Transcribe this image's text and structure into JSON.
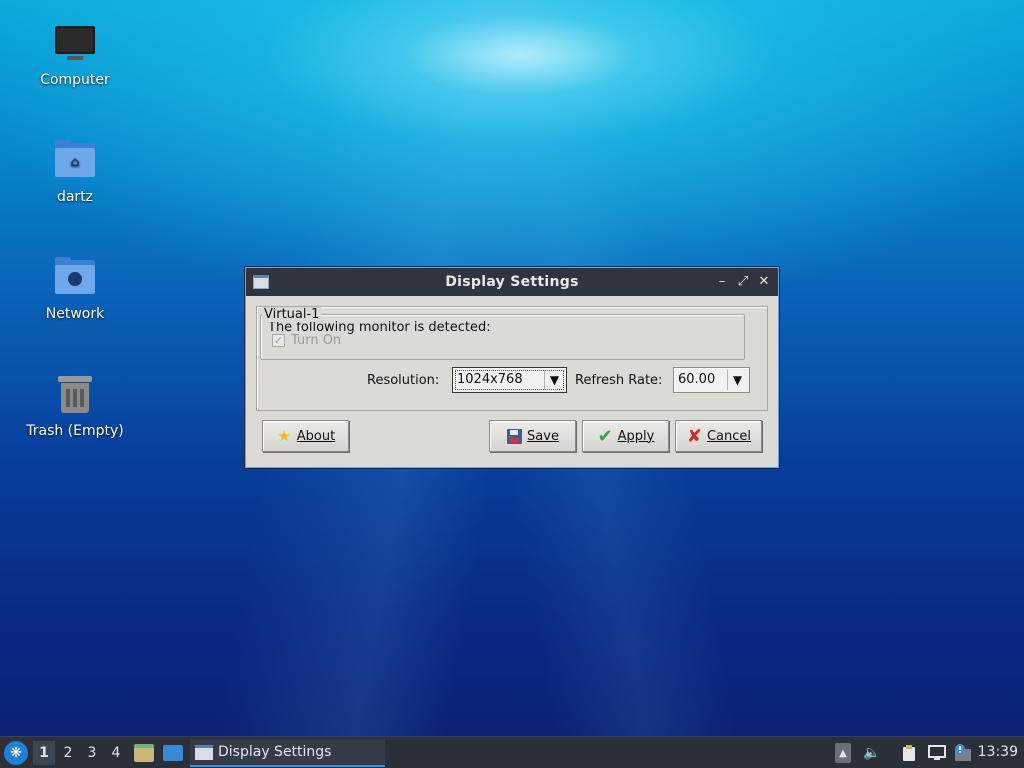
{
  "desktop": {
    "icons": [
      {
        "label": "Computer",
        "icon": "computer-icon"
      },
      {
        "label": "dartz",
        "icon": "home-folder-icon"
      },
      {
        "label": "Network",
        "icon": "network-folder-icon"
      },
      {
        "label": "Trash (Empty)",
        "icon": "trash-icon"
      }
    ]
  },
  "dialog": {
    "title": "Display Settings",
    "controls": {
      "minimize": "–",
      "maximize": "⤢",
      "close": "✕"
    },
    "detected_text": "The following monitor is detected:",
    "monitor": {
      "name": "Virtual-1",
      "turn_on_label": "Turn On",
      "turn_on_checked": true,
      "turn_on_enabled": false,
      "resolution_label": "Resolution:",
      "resolution_value": "1024x768",
      "refresh_label": "Refresh Rate:",
      "refresh_value": "60.00"
    },
    "buttons": {
      "about": "About",
      "save": "Save",
      "apply": "Apply",
      "cancel": "Cancel"
    }
  },
  "taskbar": {
    "workspaces": [
      "1",
      "2",
      "3",
      "4"
    ],
    "active_workspace": "1",
    "task_label": "Display Settings",
    "clock": "13:39"
  },
  "colors": {
    "titlebar": "#2f3440",
    "dialog_bg": "#dcdad5",
    "taskbar": "#2a2f38",
    "accent": "#3d8fe0"
  }
}
